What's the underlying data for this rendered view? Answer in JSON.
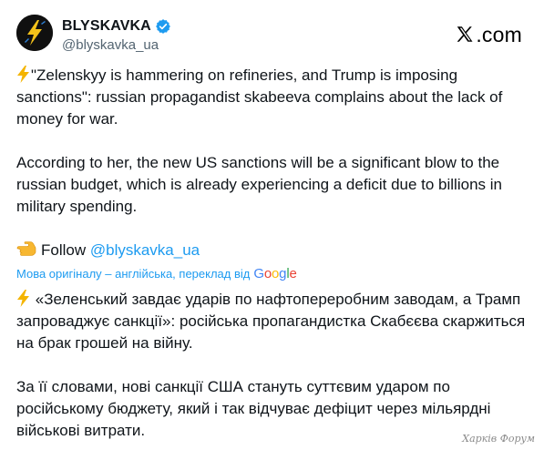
{
  "author": {
    "display_name": "BLYSKAVKA",
    "handle": "@blyskavka_ua",
    "verified": true,
    "avatar_icon": "lightning-bolt-icon"
  },
  "brand": {
    "text": ".com",
    "icon": "x-logo-icon"
  },
  "post_en": {
    "p1": "\"Zelenskyy is hammering on refineries, and Trump is imposing sanctions\": russian propagandist skabeeva complains about the lack of money for war.",
    "p2": "According to her, the new US sanctions will be a significant blow to the russian budget, which is already experiencing a deficit due to billions in military spending.",
    "follow_text": "Follow",
    "follow_handle": "@blyskavka_ua"
  },
  "translation": {
    "label": "Мова оригіналу – англійська, переклад від",
    "provider": "Google",
    "p1": "«Зеленський завдає ударів по нафтопереробним заводам, а Трамп запроваджує санкції»: російська пропагандистка Скабєєва скаржиться на брак грошей на війну.",
    "p2": "За її словами, нові санкції США стануть суттєвим ударом по російському бюджету, який і так відчуває дефіцит через мільярдні військові витрати."
  },
  "watermark": "Харків Форум",
  "colors": {
    "link": "#1d9bf0",
    "text": "#0f1419",
    "muted": "#536471",
    "bolt": "#f4b400",
    "avatar_bg": "#101010"
  }
}
